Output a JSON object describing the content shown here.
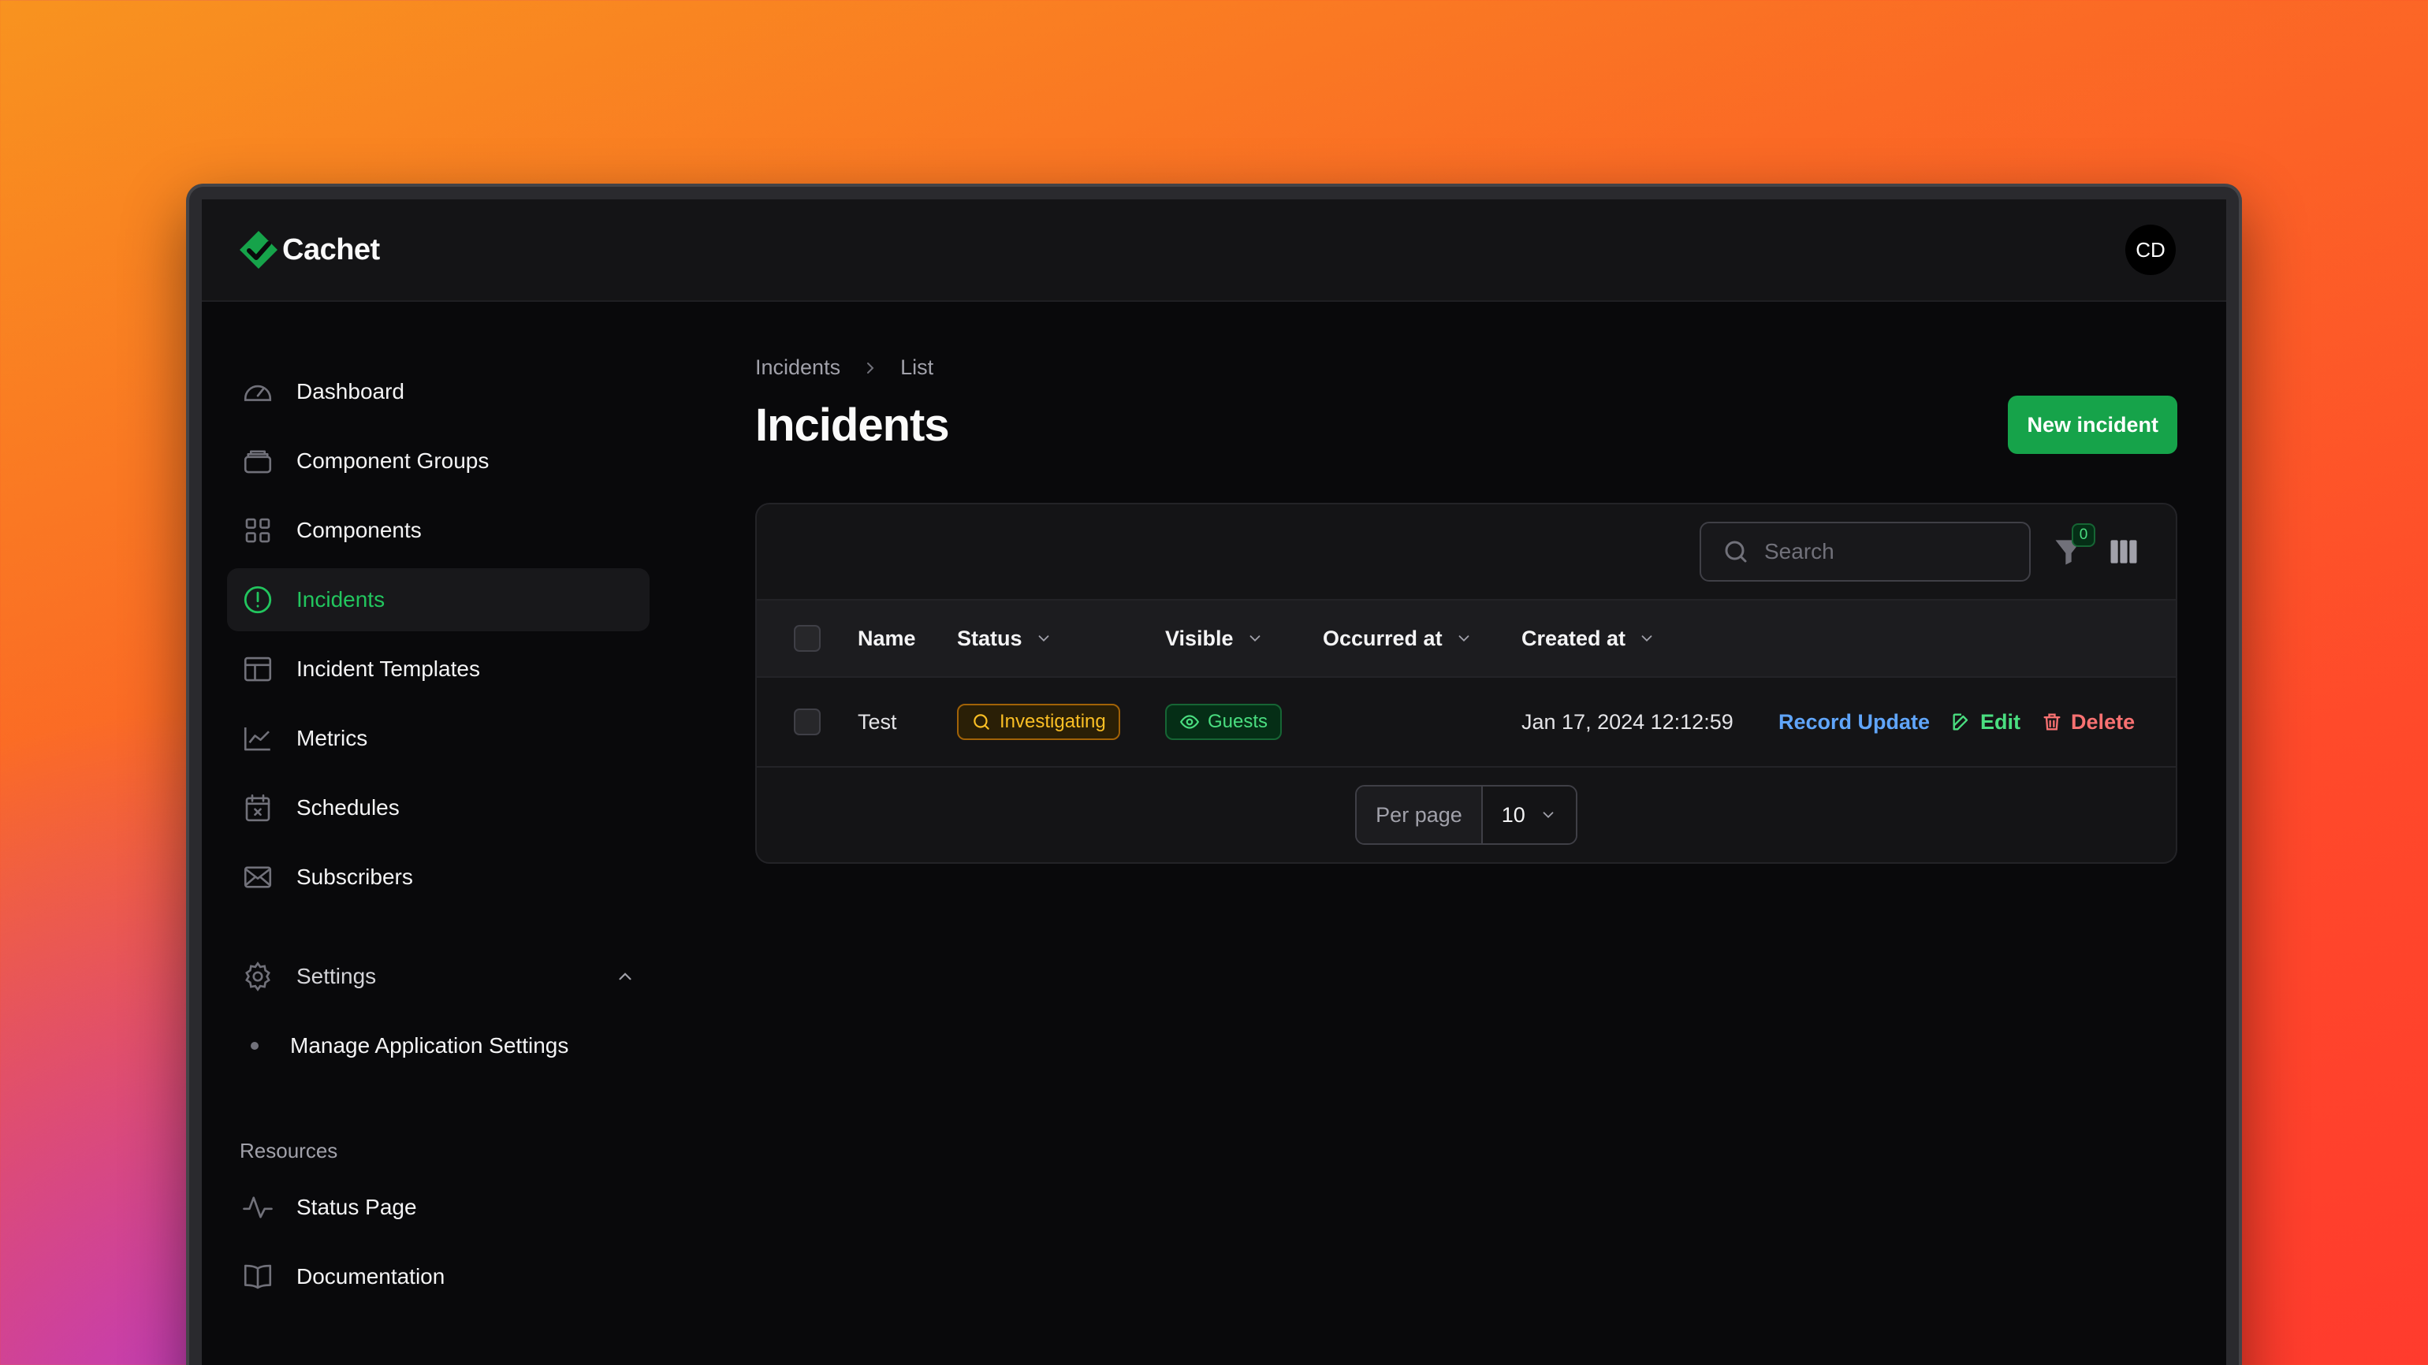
{
  "app": {
    "name": "Cachet",
    "user_initials": "CD",
    "accent": "#16a34a"
  },
  "sidebar": {
    "items": [
      {
        "label": "Dashboard",
        "icon": "gauge-icon"
      },
      {
        "label": "Component Groups",
        "icon": "stack-icon"
      },
      {
        "label": "Components",
        "icon": "grid-icon"
      },
      {
        "label": "Incidents",
        "icon": "exclamation-circle-icon",
        "active": true
      },
      {
        "label": "Incident Templates",
        "icon": "template-icon"
      },
      {
        "label": "Metrics",
        "icon": "chart-line-icon"
      },
      {
        "label": "Schedules",
        "icon": "calendar-icon"
      },
      {
        "label": "Subscribers",
        "icon": "envelope-icon"
      }
    ],
    "settings": {
      "label": "Settings",
      "sub_items": [
        "Manage Application Settings"
      ]
    },
    "resources": {
      "label": "Resources",
      "items": [
        {
          "label": "Status Page",
          "icon": "pulse-icon"
        },
        {
          "label": "Documentation",
          "icon": "book-icon"
        }
      ]
    }
  },
  "breadcrumb": [
    "Incidents",
    "List"
  ],
  "page": {
    "title": "Incidents",
    "new_button": "New incident"
  },
  "table": {
    "search_placeholder": "Search",
    "filter_count": "0",
    "columns": [
      "Name",
      "Status",
      "Visible",
      "Occurred at",
      "Created at"
    ],
    "rows": [
      {
        "name": "Test",
        "status": "Investigating",
        "visible": "Guests",
        "occurred_at": "",
        "created_at": "Jan 17, 2024 12:12:59",
        "actions": {
          "record_update": "Record Update",
          "edit": "Edit",
          "delete": "Delete"
        }
      }
    ],
    "pagination": {
      "per_page_label": "Per page",
      "per_page_value": "10"
    }
  }
}
